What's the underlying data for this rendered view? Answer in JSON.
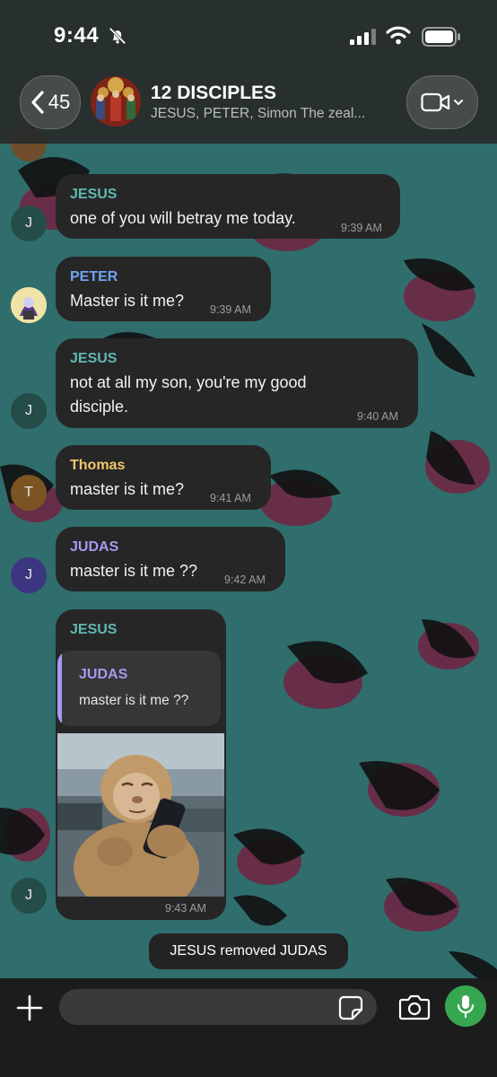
{
  "status_bar": {
    "time": "9:44"
  },
  "header": {
    "back_count": "45",
    "title": "12 DISCIPLES",
    "members": "JESUS, PETER, Simon The zeal..."
  },
  "colors": {
    "jesus": "#5fb9b0",
    "peter": "#6fa4f2",
    "thomas": "#f0c86a",
    "judas": "#a898f0",
    "mic_button": "#36a651",
    "bubble": "#262626"
  },
  "messages": [
    {
      "sender": "JESUS",
      "text": "one of you will betray me today.",
      "time": "9:39 AM",
      "avatar": "J"
    },
    {
      "sender": "PETER",
      "text": "Master is it me?",
      "time": "9:39 AM",
      "avatar": ""
    },
    {
      "sender": "JESUS",
      "text_line1": "not at all my son, you're my good",
      "text_line2": "disciple.",
      "time": "9:40 AM",
      "avatar": "J"
    },
    {
      "sender": "Thomas",
      "text": "master is it me?",
      "time": "9:41 AM",
      "avatar": "T"
    },
    {
      "sender": "JUDAS",
      "text": "master is it me ??",
      "time": "9:42 AM",
      "avatar": "J"
    },
    {
      "sender": "JESUS",
      "reply_to_sender": "JUDAS",
      "reply_to_text": "master is it me ??",
      "image": "monkey-using-phone",
      "time": "9:43 AM",
      "avatar": "J"
    }
  ],
  "system_message": "JESUS removed JUDAS",
  "composer": {
    "placeholder": ""
  },
  "icons": [
    "bell-slash-icon",
    "signal-icon",
    "wifi-icon",
    "battery-icon",
    "chevron-left-icon",
    "video-camera-icon",
    "chevron-down-icon",
    "plus-icon",
    "sticker-icon",
    "camera-icon",
    "microphone-icon"
  ]
}
